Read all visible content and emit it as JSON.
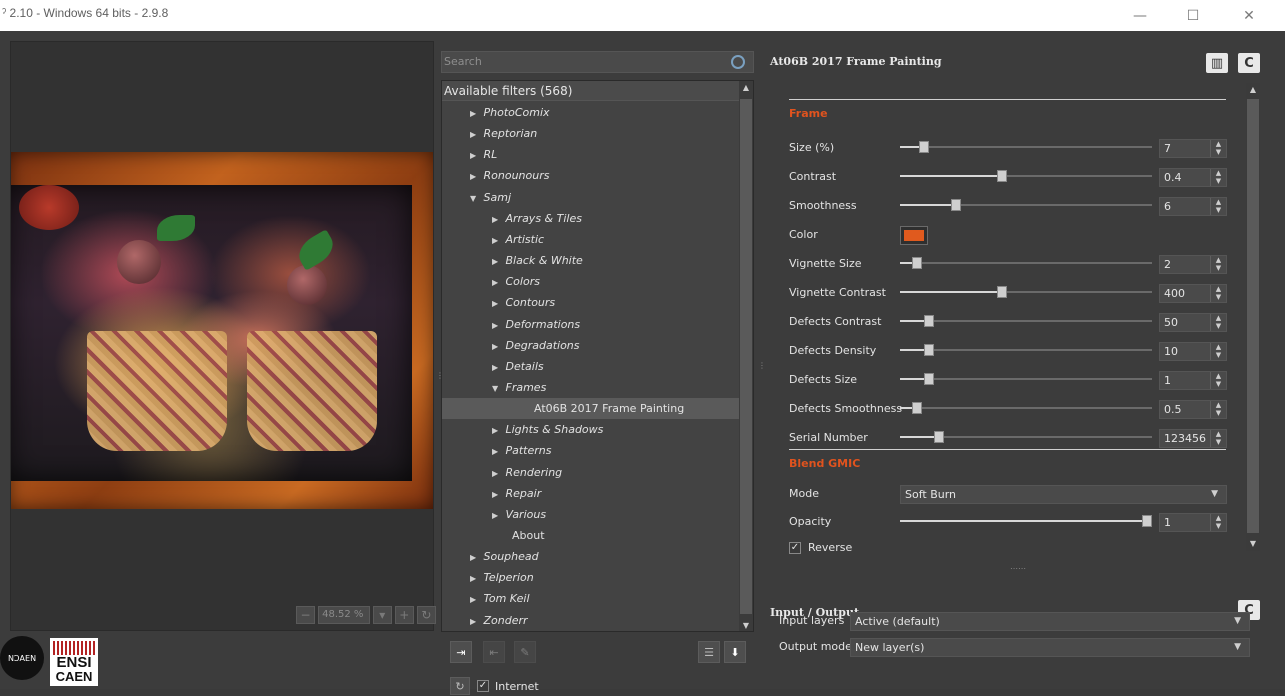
{
  "window": {
    "title": "ˀ 2.10 - Windows 64 bits - 2.9.8",
    "minimize": "—",
    "maximize": "☐",
    "close": "✕"
  },
  "preview": {
    "zoom_value": "48.52 %"
  },
  "logos": {
    "caen_text": "NƆAEN",
    "ensi_line1": "ENSI",
    "ensi_line2": "CAEN"
  },
  "filters": {
    "search_placeholder": "Search",
    "header": "Available filters (568)",
    "items": [
      {
        "label": "PhotoComix",
        "level": 1,
        "expanded": false
      },
      {
        "label": "Reptorian",
        "level": 1,
        "expanded": false
      },
      {
        "label": "RL",
        "level": 1,
        "expanded": false
      },
      {
        "label": "Ronounours",
        "level": 1,
        "expanded": false
      },
      {
        "label": "Samj",
        "level": 1,
        "expanded": true
      },
      {
        "label": "Arrays & Tiles",
        "level": 2,
        "expanded": false
      },
      {
        "label": "Artistic",
        "level": 2,
        "expanded": false
      },
      {
        "label": "Black & White",
        "level": 2,
        "expanded": false
      },
      {
        "label": "Colors",
        "level": 2,
        "expanded": false
      },
      {
        "label": "Contours",
        "level": 2,
        "expanded": false
      },
      {
        "label": "Deformations",
        "level": 2,
        "expanded": false
      },
      {
        "label": "Degradations",
        "level": 2,
        "expanded": false
      },
      {
        "label": "Details",
        "level": 2,
        "expanded": false
      },
      {
        "label": "Frames",
        "level": 2,
        "expanded": true
      },
      {
        "label": "At06B 2017 Frame Painting",
        "level": 3,
        "selected": true
      },
      {
        "label": "Lights & Shadows",
        "level": 2,
        "expanded": false
      },
      {
        "label": "Patterns",
        "level": 2,
        "expanded": false
      },
      {
        "label": "Rendering",
        "level": 2,
        "expanded": false
      },
      {
        "label": "Repair",
        "level": 2,
        "expanded": false
      },
      {
        "label": "Various",
        "level": 2,
        "expanded": false
      },
      {
        "label": "About",
        "level": 2,
        "leaf": true
      },
      {
        "label": "Souphead",
        "level": 1,
        "expanded": false
      },
      {
        "label": "Telperion",
        "level": 1,
        "expanded": false
      },
      {
        "label": "Tom Keil",
        "level": 1,
        "expanded": false
      },
      {
        "label": "Zonderr",
        "level": 1,
        "expanded": false
      }
    ],
    "internet_label": "Internet",
    "internet_checked": "✓"
  },
  "params": {
    "title": "At06B 2017 Frame Painting",
    "accent_color": "#e0531e",
    "frame_section": "Frame",
    "rows": [
      {
        "label": "Size (%)",
        "value": "7",
        "fraction": 0.08
      },
      {
        "label": "Contrast",
        "value": "0.4",
        "fraction": 0.4
      },
      {
        "label": "Smoothness",
        "value": "6",
        "fraction": 0.21
      },
      {
        "label": "Vignette Size",
        "value": "2",
        "fraction": 0.05
      },
      {
        "label": "Vignette Contrast",
        "value": "400",
        "fraction": 0.4
      },
      {
        "label": "Defects Contrast",
        "value": "50",
        "fraction": 0.1
      },
      {
        "label": "Defects Density",
        "value": "10",
        "fraction": 0.1
      },
      {
        "label": "Defects Size",
        "value": "1",
        "fraction": 0.1
      },
      {
        "label": "Defects Smoothness",
        "value": "0.5",
        "fraction": 0.05
      },
      {
        "label": "Serial Number",
        "value": "123456",
        "fraction": 0.14
      }
    ],
    "color_label": "Color",
    "color_value": "#e05a1e",
    "blend_section": "Blend GMIC",
    "mode_label": "Mode",
    "mode_value": "Soft Burn",
    "opacity_label": "Opacity",
    "opacity_value": "1",
    "opacity_fraction": 1.0,
    "reverse_label": "Reverse",
    "reverse_checked": "✓"
  },
  "io": {
    "title": "Input / Output",
    "input_label": "Input layers",
    "input_value": "Active (default)",
    "output_label": "Output mode",
    "output_value": "New layer(s)"
  }
}
